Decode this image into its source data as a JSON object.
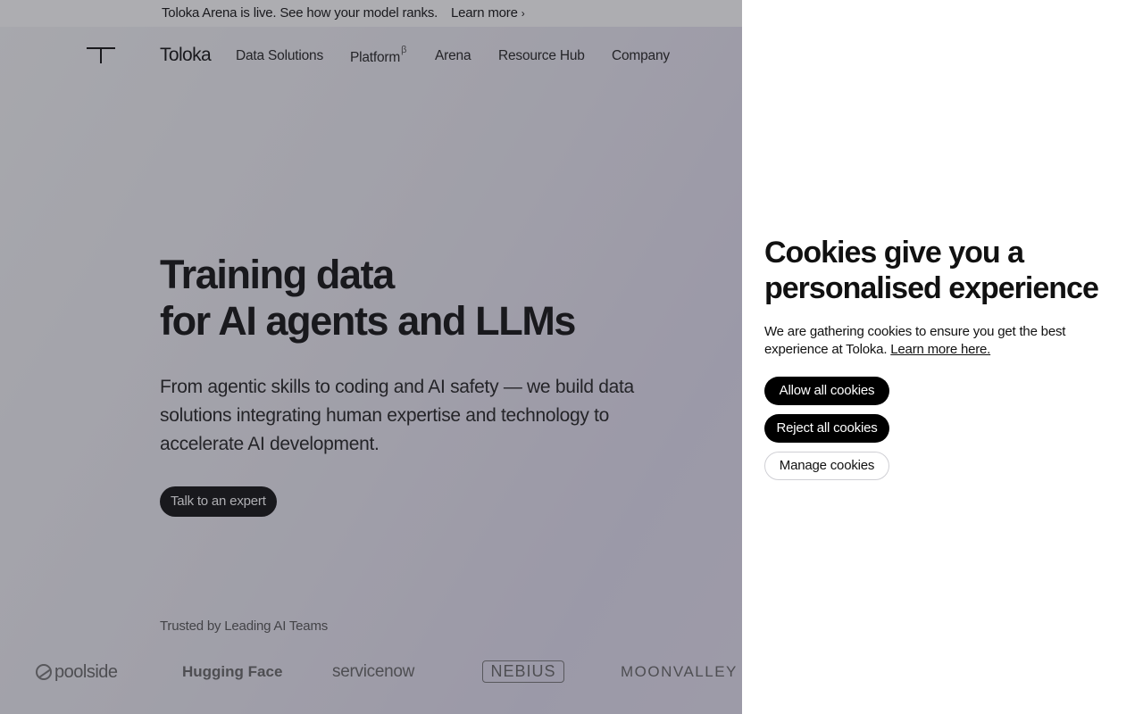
{
  "banner": {
    "text": "Toloka Arena is live. See how your model ranks.",
    "link": "Learn more",
    "link_chevron": "›"
  },
  "header": {
    "logo_icon": "toloka-t-icon",
    "brand": "Toloka",
    "nav": [
      {
        "label": "Data Solutions"
      },
      {
        "label": "Platform",
        "badge": "β"
      },
      {
        "label": "Arena"
      },
      {
        "label": "Resource Hub"
      },
      {
        "label": "Company"
      }
    ]
  },
  "hero": {
    "title_line1": "Training data",
    "title_line2": "for AI agents and LLMs",
    "subtitle": "From agentic skills to coding and AI safety — we build data solutions integrating human expertise and technology to accelerate AI development.",
    "cta": "Talk to an expert"
  },
  "trusted": {
    "label": "Trusted by Leading AI Teams",
    "logos": [
      "poolside",
      "Hugging Face",
      "servicenow",
      "NEBIUS",
      "MOONVALLEY"
    ]
  },
  "cookies": {
    "title": "Cookies give you a personalised experience",
    "description": "We are gathering cookies to ensure you get the best experience at Toloka.",
    "learn_more": "Learn more here.",
    "allow": "Allow all cookies",
    "reject": "Reject all cookies",
    "manage": "Manage cookies"
  },
  "colors": {
    "primary_button": "#000000",
    "panel_background": "#ffffff",
    "overlay": "#28283261"
  }
}
